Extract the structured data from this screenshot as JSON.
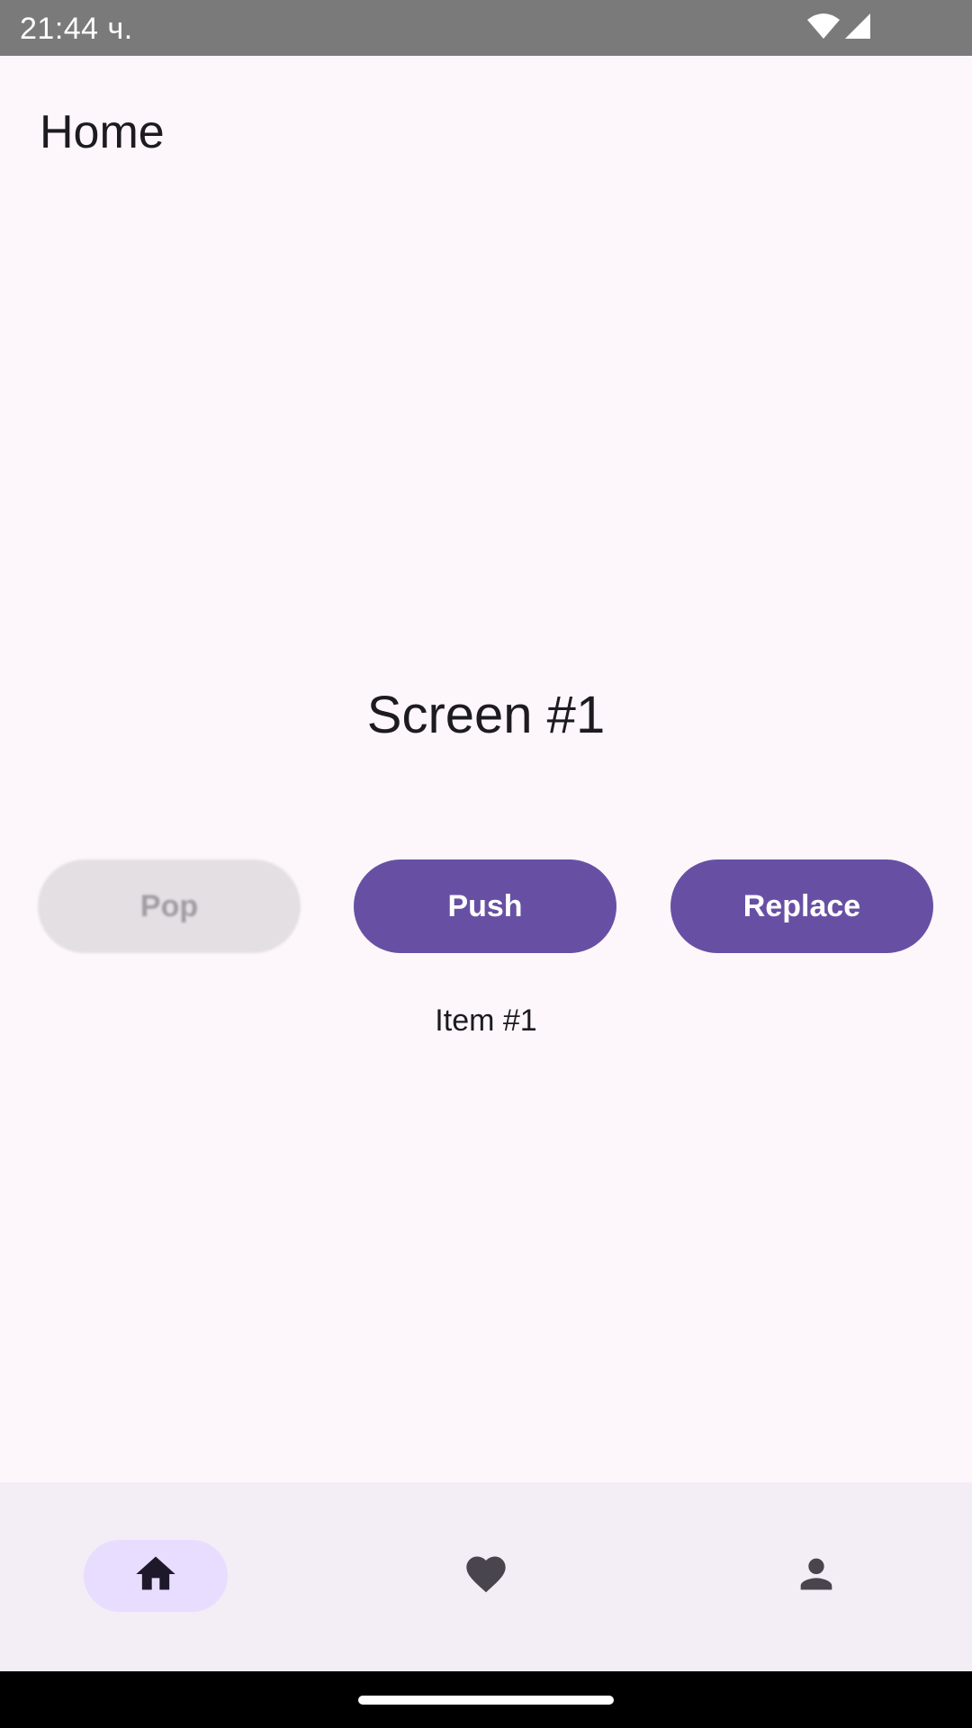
{
  "status_bar": {
    "time": "21:44 ч.",
    "icons": [
      "wifi-icon",
      "cellular-signal-icon"
    ]
  },
  "app_bar": {
    "title": "Home"
  },
  "main": {
    "screen_title": "Screen #1",
    "buttons": {
      "pop": "Pop",
      "push": "Push",
      "replace": "Replace"
    },
    "item_label": "Item #1"
  },
  "bottom_nav": {
    "items": [
      {
        "icon": "home-icon",
        "selected": true
      },
      {
        "icon": "heart-icon",
        "selected": false
      },
      {
        "icon": "person-icon",
        "selected": false
      }
    ]
  },
  "colors": {
    "primary": "#6750a4",
    "background": "#fdf7fb",
    "nav_background": "#f3edf5",
    "nav_indicator": "#e9ddff",
    "disabled_button": "#e3dfe3",
    "status_bar": "#7a7a7a"
  }
}
